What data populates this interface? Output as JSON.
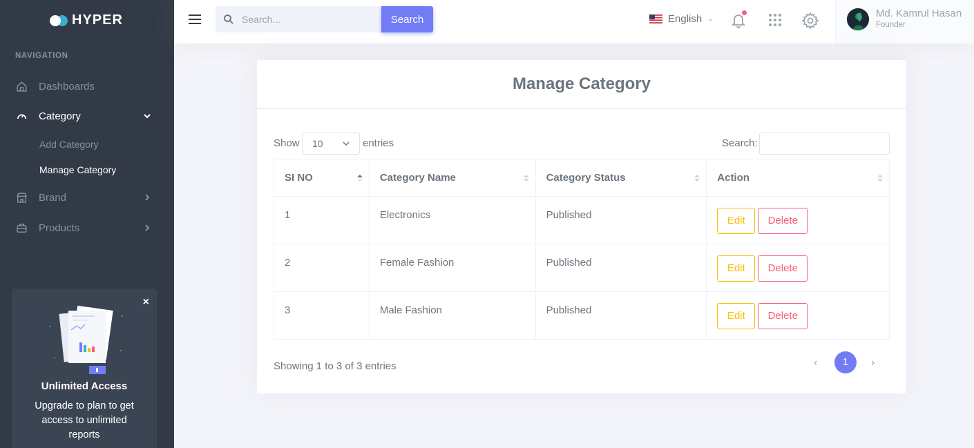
{
  "brand": {
    "name": "HYPER",
    "accent": "#727cf5"
  },
  "sidebar": {
    "nav_title": "NAVIGATION",
    "items": [
      {
        "label": "Dashboards",
        "icon": "home-icon"
      },
      {
        "label": "Category",
        "icon": "gauge-icon",
        "expanded": true
      },
      {
        "label": "Brand",
        "icon": "store-icon"
      },
      {
        "label": "Products",
        "icon": "briefcase-icon"
      }
    ],
    "category_sub": [
      {
        "label": "Add Category"
      },
      {
        "label": "Manage Category",
        "active": true
      }
    ],
    "promo": {
      "title": "Unlimited Access",
      "text": "Upgrade to plan to get access to unlimited reports",
      "close": "×"
    }
  },
  "topbar": {
    "search_placeholder": "Search...",
    "search_button": "Search",
    "language": "English",
    "user": {
      "name": "Md. Kamrul Hasan",
      "role": "Founder"
    }
  },
  "page": {
    "title": "Manage Category",
    "length_label": "Show",
    "length_value": "10",
    "length_after": "entries",
    "filter_label": "Search:",
    "filter_value": "",
    "columns": [
      "SI NO",
      "Category Name",
      "Category Status",
      "Action"
    ],
    "rows": [
      {
        "si": "1",
        "name": "Electronics",
        "status": "Published"
      },
      {
        "si": "2",
        "name": "Female Fashion",
        "status": "Published"
      },
      {
        "si": "3",
        "name": "Male Fashion",
        "status": "Published"
      }
    ],
    "edit_label": "Edit",
    "delete_label": "Delete",
    "info": "Showing 1 to 3 of 3 entries",
    "pagination": {
      "prev": "‹",
      "current": "1",
      "next": "›"
    }
  }
}
